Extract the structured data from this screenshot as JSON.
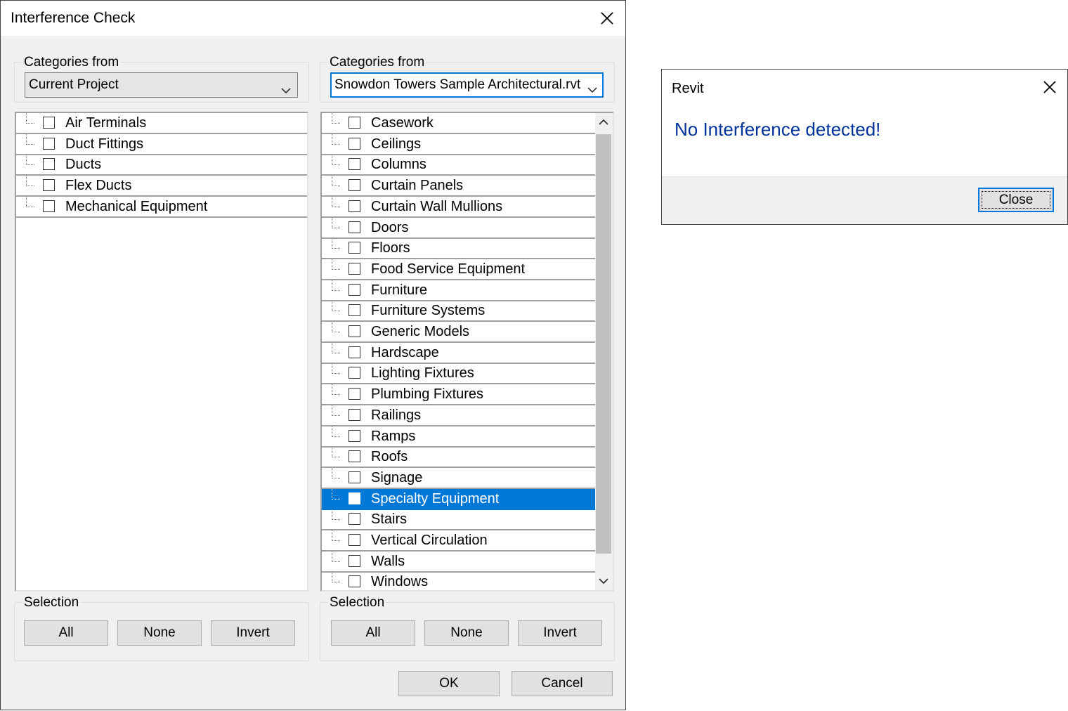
{
  "main_dialog": {
    "title": "Interference Check",
    "left_panel": {
      "categories_label": "Categories from",
      "source": "Current Project",
      "items": [
        "Air Terminals",
        "Duct Fittings",
        "Ducts",
        "Flex Ducts",
        "Mechanical Equipment"
      ],
      "selection_label": "Selection",
      "buttons": {
        "all": "All",
        "none": "None",
        "invert": "Invert"
      }
    },
    "right_panel": {
      "categories_label": "Categories from",
      "source": "Snowdon Towers Sample Architectural.rvt",
      "items": [
        "Casework",
        "Ceilings",
        "Columns",
        "Curtain Panels",
        "Curtain Wall Mullions",
        "Doors",
        "Floors",
        "Food Service Equipment",
        "Furniture",
        "Furniture Systems",
        "Generic Models",
        "Hardscape",
        "Lighting Fixtures",
        "Plumbing Fixtures",
        "Railings",
        "Ramps",
        "Roofs",
        "Signage",
        "Specialty Equipment",
        "Stairs",
        "Vertical Circulation",
        "Walls",
        "Windows"
      ],
      "selected_item": "Specialty Equipment",
      "selection_label": "Selection",
      "buttons": {
        "all": "All",
        "none": "None",
        "invert": "Invert"
      }
    },
    "ok_label": "OK",
    "cancel_label": "Cancel"
  },
  "revit_dialog": {
    "title": "Revit",
    "message": "No Interference detected!",
    "close_label": "Close"
  },
  "colors": {
    "accent": "#0078d7",
    "message_text": "#003399",
    "dialog_bg": "#f0f0f0"
  },
  "icons": {
    "close": "close-icon",
    "dropdown": "chevron-down-icon",
    "scroll_up": "scroll-up-icon",
    "scroll_down": "scroll-down-icon"
  }
}
